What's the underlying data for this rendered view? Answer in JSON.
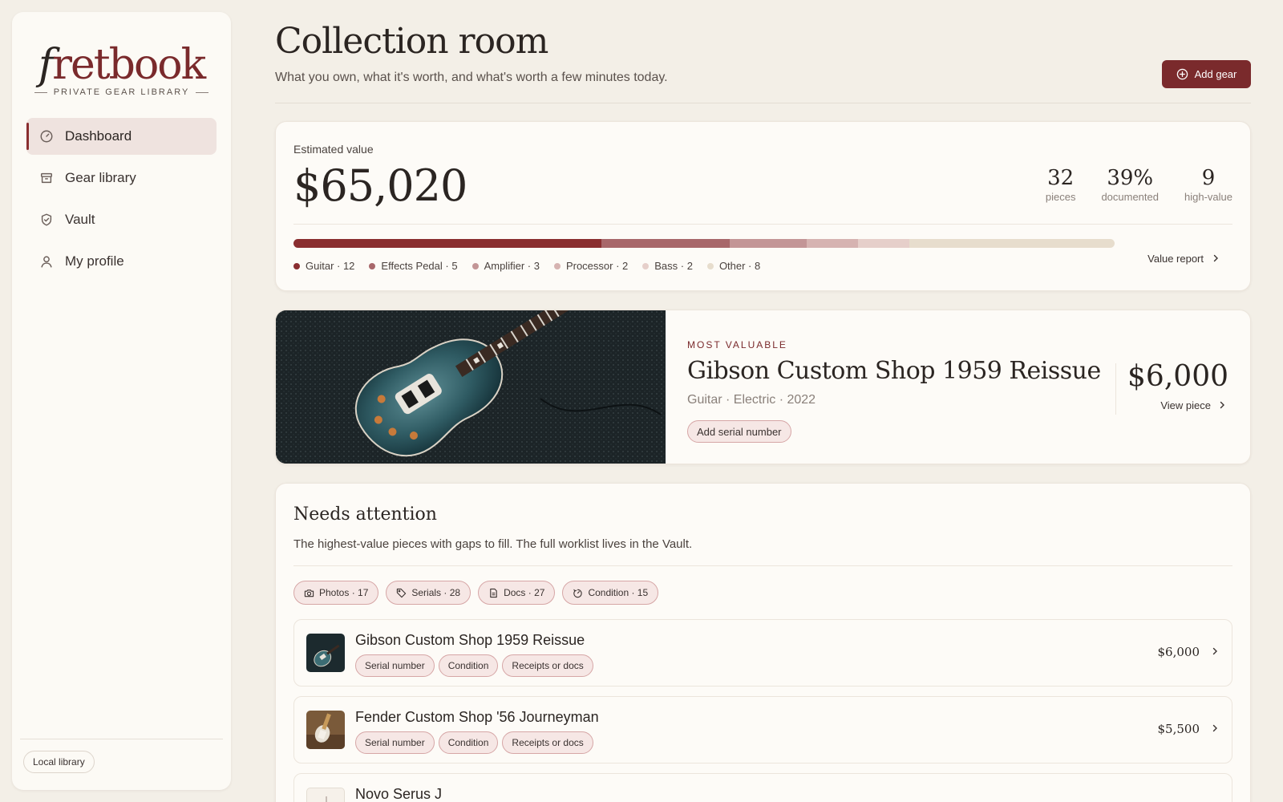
{
  "brand": {
    "logo_f": "f",
    "logo_rest": "retbook",
    "tagline": "PRIVATE GEAR LIBRARY",
    "accent": "#7a2a2c"
  },
  "nav": [
    {
      "label": "Dashboard",
      "icon": "gauge-icon",
      "active": true
    },
    {
      "label": "Gear library",
      "icon": "archive-box-icon",
      "active": false
    },
    {
      "label": "Vault",
      "icon": "shield-check-icon",
      "active": false
    },
    {
      "label": "My profile",
      "icon": "user-icon",
      "active": false
    }
  ],
  "sidebar_footer": {
    "label": "Local library"
  },
  "header": {
    "title": "Collection room",
    "subtitle": "What you own, what it's worth, and what's worth a few minutes today.",
    "add_button": "Add gear"
  },
  "value": {
    "label": "Estimated value",
    "amount": "$65,020",
    "stats": [
      {
        "value": "32",
        "label": "pieces"
      },
      {
        "value": "39%",
        "label": "documented"
      },
      {
        "value": "9",
        "label": "high-value"
      }
    ],
    "categories": [
      {
        "label": "Guitar · 12",
        "count": 12,
        "color": "#8a2e30"
      },
      {
        "label": "Effects Pedal · 5",
        "count": 5,
        "color": "#a8676a"
      },
      {
        "label": "Amplifier · 3",
        "count": 3,
        "color": "#c39596"
      },
      {
        "label": "Processor · 2",
        "count": 2,
        "color": "#d6b3b1"
      },
      {
        "label": "Bass · 2",
        "count": 2,
        "color": "#e6cfca"
      },
      {
        "label": "Other · 8",
        "count": 8,
        "color": "#e7ddcd"
      }
    ],
    "report_link": "Value report"
  },
  "featured": {
    "eyebrow": "MOST VALUABLE",
    "name": "Gibson Custom Shop 1959 Reissue",
    "meta": "Guitar · Electric · 2022",
    "action": "Add serial number",
    "price": "$6,000",
    "view_link": "View piece"
  },
  "attention": {
    "title": "Needs attention",
    "subtitle": "The highest-value pieces with gaps to fill. The full worklist lives in the Vault.",
    "chips": [
      {
        "label": "Photos · 17",
        "icon": "camera-icon"
      },
      {
        "label": "Serials · 28",
        "icon": "tag-icon"
      },
      {
        "label": "Docs · 27",
        "icon": "document-icon"
      },
      {
        "label": "Condition · 15",
        "icon": "condition-icon"
      }
    ],
    "items": [
      {
        "name": "Gibson Custom Shop 1959 Reissue",
        "tags": [
          "Serial number",
          "Condition",
          "Receipts or docs"
        ],
        "price": "$6,000"
      },
      {
        "name": "Fender Custom Shop '56 Journeyman",
        "tags": [
          "Serial number",
          "Condition",
          "Receipts or docs"
        ],
        "price": "$5,500"
      },
      {
        "name": "Novo Serus J",
        "tags": [],
        "price": ""
      }
    ]
  }
}
